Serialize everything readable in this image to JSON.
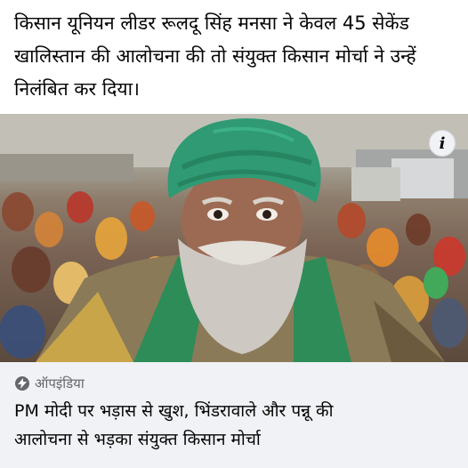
{
  "post": {
    "text_lines": [
      "किसान यूनियन लीडर रूलदू सिंह मनसा ने केवल 45 सेकेंड",
      "खालिस्तान की आलोचना की तो संयुक्त किसान मोर्चा ने उन्हें",
      "निलंबित कर दिया।"
    ]
  },
  "image": {
    "info_label": "i",
    "icon": "info-icon"
  },
  "link_card": {
    "source": "ऑपइंडिया",
    "source_icon": "lightning-bolt-icon",
    "headline_lines": [
      "PM मोदी पर भड़ास से खुश, भिंडरावाले और पन्नू की",
      "आलोचना से भड़का संयुक्त किसान मोर्चा"
    ]
  },
  "colors": {
    "card_background": "#f0f2f5",
    "secondary_text": "#65676b",
    "turban_green": "#2f9a74"
  }
}
